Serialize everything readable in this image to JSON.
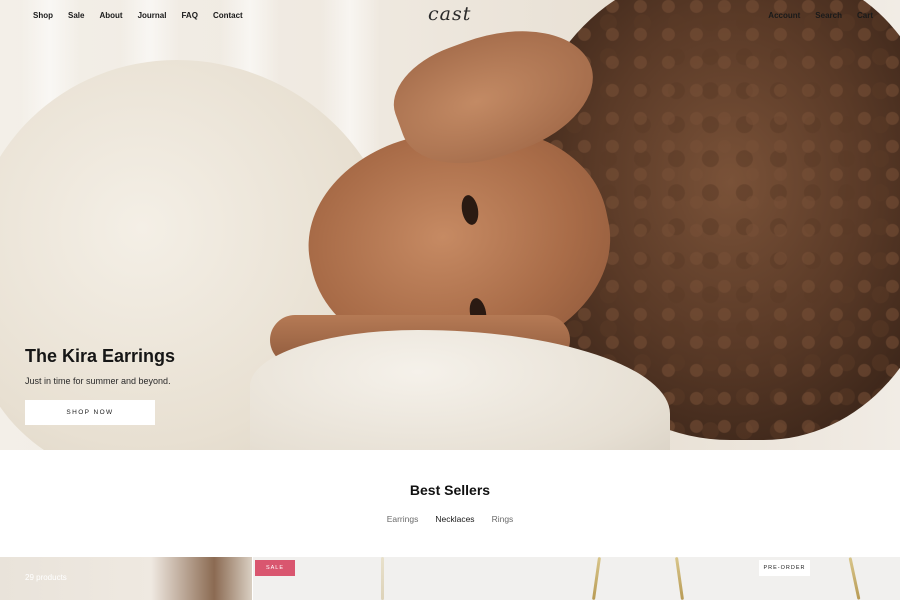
{
  "nav": {
    "left_links": [
      "Shop",
      "Sale",
      "About",
      "Journal",
      "FAQ",
      "Contact"
    ],
    "logo": "cast",
    "right_links": [
      "Account",
      "Search",
      "Cart"
    ]
  },
  "hero": {
    "title": "The Kira Earrings",
    "subtitle": "Just in time for summer and beyond.",
    "button_label": "SHOP NOW"
  },
  "best_sellers": {
    "title": "Best Sellers",
    "tabs": [
      "Earrings",
      "Necklaces",
      "Rings"
    ],
    "active_tab": "Necklaces"
  },
  "products": {
    "count_label": "29 products",
    "badges": [
      "SALE",
      "PRE-ORDER"
    ]
  },
  "colors": {
    "sale_badge": "#d9566f",
    "text": "#1a1a1a"
  }
}
